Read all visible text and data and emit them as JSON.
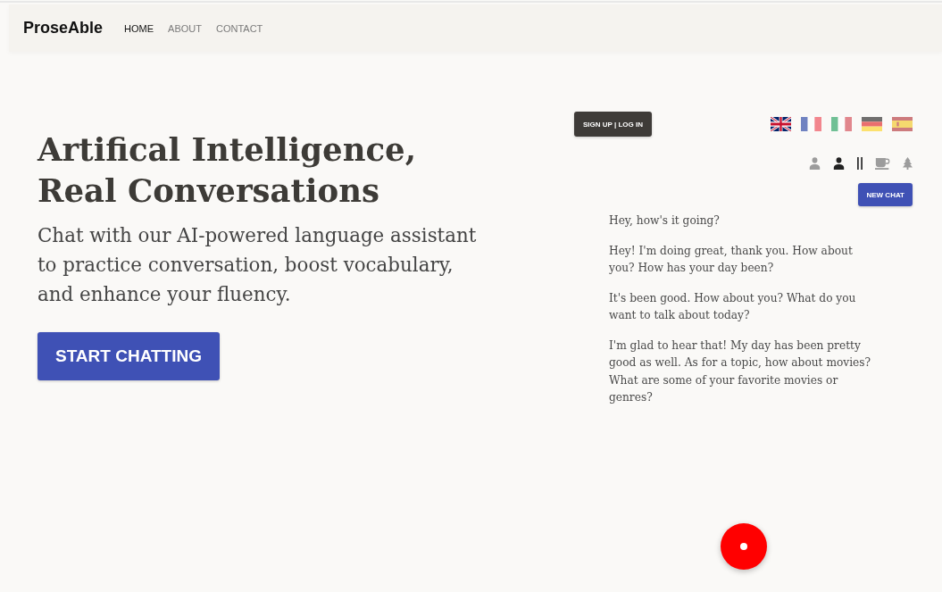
{
  "navbar": {
    "logo": "ProseAble",
    "links": [
      {
        "label": "HOME",
        "selected": true
      },
      {
        "label": "ABOUT",
        "selected": false
      },
      {
        "label": "CONTACT",
        "selected": false
      }
    ]
  },
  "hero": {
    "title": "Artifical Intelligence, Real Conversations",
    "subtitle": "Chat with our AI-powered language assistant to practice conversation, boost vocabulary, and enhance your fluency.",
    "cta_button": "START CHATTING"
  },
  "chat_panel": {
    "auth_button": "SIGN UP | LOG IN",
    "languages": [
      {
        "kind": "uk",
        "selected": true
      },
      {
        "kind": "fr",
        "selected": false
      },
      {
        "kind": "it",
        "selected": false
      },
      {
        "kind": "de",
        "selected": false
      },
      {
        "kind": "es",
        "selected": false
      }
    ],
    "avatars": [
      {
        "selected": false
      },
      {
        "selected": true
      }
    ],
    "scenes": [
      {
        "kind": "cup",
        "selected": false
      },
      {
        "kind": "tree",
        "selected": false
      }
    ],
    "new_chat_button": "NEW CHAT",
    "messages": [
      "Hey, how's it going?",
      "Hey! I'm doing great, thank you. How about you? How has your day been?",
      "It's been good. How about you? What do you want to talk about today?",
      "I'm glad to hear that! My day has been pretty good as well. As for a topic, how about movies? What are some of your favorite movies or genres?"
    ]
  }
}
